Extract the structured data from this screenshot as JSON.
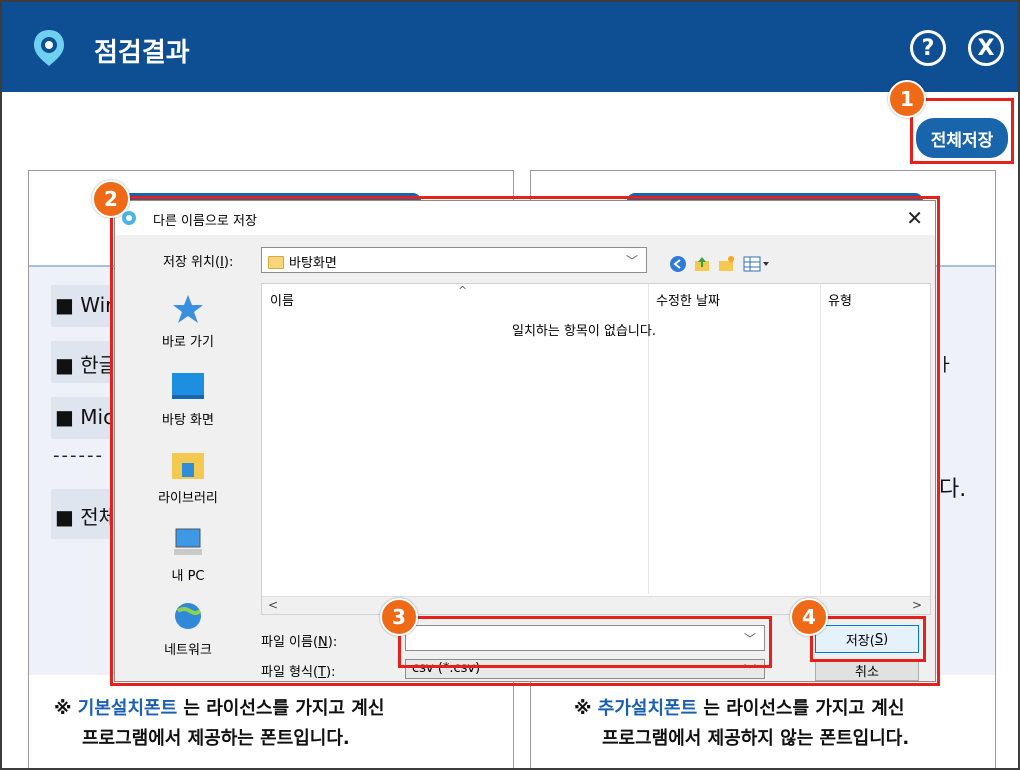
{
  "app": {
    "title": "점검결과",
    "help_label": "?",
    "close_label": "X",
    "save_all_label": "전체저장"
  },
  "badges": [
    "1",
    "2",
    "3",
    "4"
  ],
  "background": {
    "left_rows": [
      "■ Wir",
      "■ 한글",
      "■ Mic",
      "■ 전체"
    ],
    "dashes": "------",
    "right_fragments": [
      "다.",
      "ㅏ"
    ],
    "left_note": {
      "mark": "※",
      "highlight": "기본설치폰트",
      "rest_line1": "는 라이선스를 가지고 계신",
      "line2": "프로그램에서 제공하는 폰트입니다."
    },
    "right_note": {
      "mark": "※",
      "highlight": "추가설치폰트",
      "rest_line1": "는 라이선스를 가지고 계신",
      "line2": "프로그램에서 제공하지 않는 폰트입니다."
    }
  },
  "dialog": {
    "title": "다른 이름으로 저장",
    "close_label": "✕",
    "location_label": "저장 위치(",
    "location_key": "I",
    "location_label_end": "):",
    "location_value": "바탕화면",
    "places": [
      {
        "label": "바로 가기",
        "icon": "star-icon"
      },
      {
        "label": "바탕 화면",
        "icon": "desktop-icon"
      },
      {
        "label": "라이브러리",
        "icon": "library-icon"
      },
      {
        "label": "내 PC",
        "icon": "computer-icon"
      },
      {
        "label": "네트워크",
        "icon": "network-icon"
      }
    ],
    "columns": [
      "이름",
      "수정한 날짜",
      "유형"
    ],
    "empty_message": "일치하는 항목이 없습니다.",
    "filename_label": "파일 이름(",
    "filename_key": "N",
    "filename_label_end": "):",
    "filename_value": "",
    "filetype_label": "파일 형식(",
    "filetype_key": "T",
    "filetype_label_end": "):",
    "filetype_value": "csv (*.csv)",
    "save_label": "저장(",
    "save_key": "S",
    "save_label_end": ")",
    "cancel_label": "취소"
  },
  "colors": {
    "titlebar": "#0e4f94",
    "accent": "#1865ac",
    "highlight_box": "#e8201a",
    "badge": "#ee6a16"
  }
}
